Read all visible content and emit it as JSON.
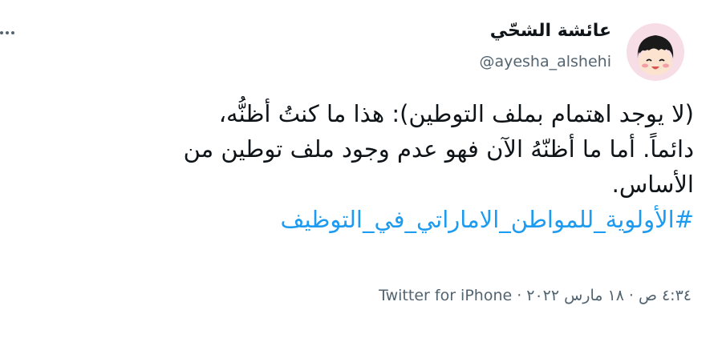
{
  "tweet": {
    "author": {
      "display_name": "عائشة الشحّي",
      "handle": "@ayesha_alshehi"
    },
    "text_lines": [
      "(لا يوجد اهتمام بملف التوطين): هذا ما كنتُ أظنُّه،",
      "دائماً. أما ما أظنّهُ الآن فهو عدم وجود ملف توطين من",
      "الأساس."
    ],
    "hashtag": "#الأولوية_للمواطن_الاماراتي_في_التوظيف",
    "time": "٤:٣٤ ص",
    "date": "١٨ مارس ٢٠٢٢",
    "separator": "·",
    "source": "Twitter for iPhone",
    "more_icon": "more-horizontal-icon",
    "colors": {
      "link": "#1d9bf0",
      "text": "#0f1419",
      "secondary": "#536471",
      "avatar_bg": "#f7dde5"
    }
  }
}
